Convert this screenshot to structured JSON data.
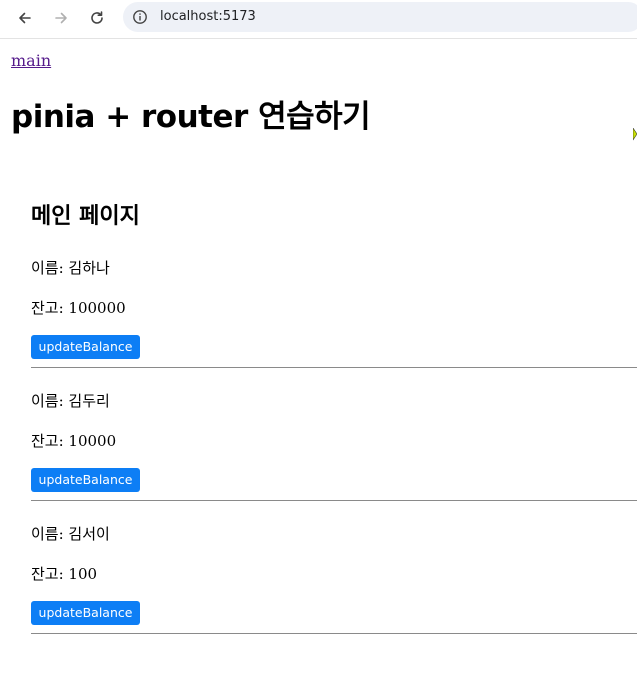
{
  "browser": {
    "url": "localhost:5173",
    "back_icon": "arrow-left-icon",
    "forward_icon": "arrow-right-icon",
    "reload_icon": "reload-icon",
    "site_info_icon": "info-icon"
  },
  "nav": {
    "main_link": "main"
  },
  "app": {
    "title": "pinia + router 연습하기"
  },
  "page": {
    "heading": "메인 페이지"
  },
  "users": [
    {
      "name_line": "이름: 김하나",
      "balance_line": "잔고: 100000",
      "button_label": "updateBalance"
    },
    {
      "name_line": "이름: 김두리",
      "balance_line": "잔고: 10000",
      "button_label": "updateBalance"
    },
    {
      "name_line": "이름: 김서이",
      "balance_line": "잔고: 100",
      "button_label": "updateBalance"
    }
  ],
  "colors": {
    "button_bg": "#0d7ef5",
    "link": "#551a8b",
    "divider": "#8a8a8a"
  }
}
